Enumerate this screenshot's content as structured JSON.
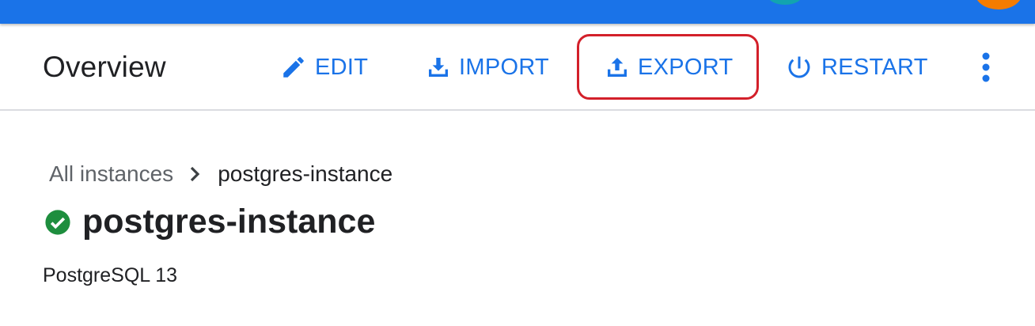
{
  "header": {
    "bar_color": "#1a73e8"
  },
  "toolbar": {
    "title": "Overview",
    "accent_color": "#1a73e8",
    "buttons": [
      {
        "label": "EDIT",
        "icon": "pencil-icon"
      },
      {
        "label": "IMPORT",
        "icon": "import-icon"
      },
      {
        "label": "EXPORT",
        "icon": "export-icon",
        "highlighted": true
      },
      {
        "label": "RESTART",
        "icon": "power-icon"
      }
    ],
    "more_icon": "more-vert-icon",
    "highlight_color": "#d3202a"
  },
  "breadcrumb": {
    "parent": "All instances",
    "separator_icon": "chevron-right-icon",
    "current": "postgres-instance"
  },
  "instance": {
    "status_icon": "check-circle-icon",
    "status_color": "#1e8e3e",
    "name": "postgres-instance",
    "version": "PostgreSQL 13"
  }
}
